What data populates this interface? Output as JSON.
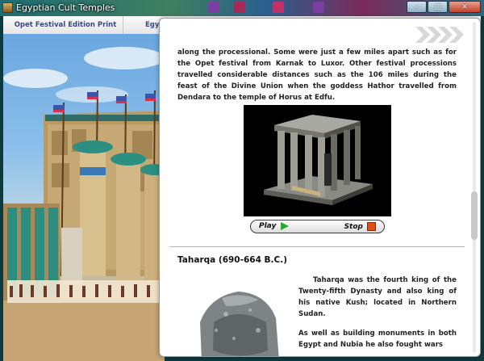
{
  "window": {
    "title": "Egyptian Cult Temples",
    "min_glyph": "–",
    "max_glyph": "□",
    "close_glyph": "✕"
  },
  "tabs": [
    {
      "label": "Opet Festival Edition Print"
    },
    {
      "label": "Egyp"
    }
  ],
  "panel": {
    "intro_paragraph": "along the processional. Some were just a few miles apart such as for the Opet festival from Karnak to Luxor. Other festival processions travelled considerable distances such as the 106 miles during the feast of the Divine Union when the goddess Hathor travelled from Dendara to the temple of Horus at Edfu.",
    "video": {
      "play_label": "Play",
      "stop_label": "Stop"
    },
    "section": {
      "title": "Taharqa (690-664 B.C.)",
      "paragraphs": [
        "Taharqa was the fourth king of the Twenty-fifth Dynasty and also king of his native Kush; located in Northern Sudan.",
        "As well as building monuments in both Egypt and Nubia he also fought wars"
      ]
    }
  },
  "colors": {
    "tab_text": "#3a4a82",
    "play_icon": "#2aa832",
    "stop_icon": "#e04f16"
  },
  "icons": [
    "app-icon",
    "minimize-icon",
    "maximize-icon",
    "close-icon",
    "next-arrows-icon",
    "play-icon",
    "stop-icon"
  ]
}
